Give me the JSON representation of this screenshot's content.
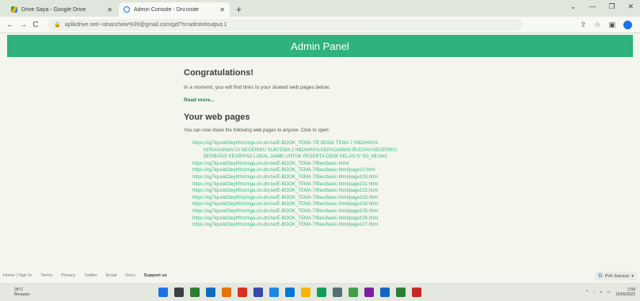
{
  "browser": {
    "tabs": [
      {
        "title": "Drive Saya - Google Drive",
        "favicon": "drive-icon",
        "active": false
      },
      {
        "title": "Admin Console - Drv.ivsite",
        "favicon": "admin-icon",
        "active": true
      }
    ],
    "url": "aplikdrive.net/~ishanchew%39@gmail.com/gd/?s=admin#output.1",
    "nav": {
      "back": "←",
      "forward": "→",
      "reload": "C"
    }
  },
  "header": {
    "title": "Admin Panel"
  },
  "main": {
    "congrats_title": "Congratulations!",
    "congrats_text": "In a moment, you will find links to your shared web pages below.",
    "read_more": "Read more...",
    "pages_title": "Your web pages",
    "pages_text": "You can now share the following web pages to anyone. Click to open:",
    "first_link": {
      "line1": "https://xg7iquxid2teyhfmzmga.on.drv.tw/E-BOOK_TEMA 7/E BOOK TEMA 7 INDAHNYA",
      "line2": "KERAGAMAN DI NEGERIKU SUBTEMA 2 INDAHNYA KERAGAMAN BUDAYA NEGERIKU",
      "line3": "BERBASIS KEARIFAN LOKAL JAMBI UNTUK PESERTA DIDIK KELAS IV SD_MI.html"
    },
    "links": [
      "https://xg7iquxid2teyhfmzmga.on.drv.tw/E-BOOK_TEMA 7/files/basic-html/",
      "https://xg7iquxid2teyhfmzmga.on.drv.tw/E-BOOK_TEMA 7/files/basic-html/page10.html",
      "https://xg7iquxid2teyhfmzmga.on.drv.tw/E-BOOK_TEMA 7/files/basic-html/page100.html",
      "https://xg7iquxid2teyhfmzmga.on.drv.tw/E-BOOK_TEMA 7/files/basic-html/page101.html",
      "https://xg7iquxid2teyhfmzmga.on.drv.tw/E-BOOK_TEMA 7/files/basic-html/page102.html",
      "https://xg7iquxid2teyhfmzmga.on.drv.tw/E-BOOK_TEMA 7/files/basic-html/page103.html",
      "https://xg7iquxid2teyhfmzmga.on.drv.tw/E-BOOK_TEMA 7/files/basic-html/page104.html",
      "https://xg7iquxid2teyhfmzmga.on.drv.tw/E-BOOK_TEMA 7/files/basic-html/page105.html",
      "https://xg7iquxid2teyhfmzmga.on.drv.tw/E-BOOK_TEMA 7/files/basic-html/page106.html",
      "https://xg7iquxid2teyhfmzmga.on.drv.tw/E-BOOK_TEMA 7/files/basic-html/page107.html"
    ]
  },
  "footer": {
    "items": [
      "Home | Sign In",
      "Terms",
      "Privacy",
      "Twitter",
      "Email",
      "Docs"
    ],
    "powered": "Support us",
    "translate": "Pilih Bahasa"
  },
  "taskbar": {
    "weather_temp": "28°C",
    "weather_desc": "Berawan",
    "time": "2:58",
    "date": "15/06/2022",
    "icon_colors": [
      "#1a73e8",
      "#3c4043",
      "#2f7d32",
      "#0f6cbd",
      "#e8710a",
      "#d93025",
      "#3949ab",
      "#1e88e5",
      "#0078d4",
      "#f4b400",
      "#0f9d58",
      "#546e7a",
      "#43a047",
      "#7b1fa2",
      "#1565c0",
      "#2e7d32",
      "#c62828"
    ]
  },
  "colors": {
    "header": "#2fb27c",
    "link": "#37b97f",
    "background": "#f4f6ee"
  }
}
